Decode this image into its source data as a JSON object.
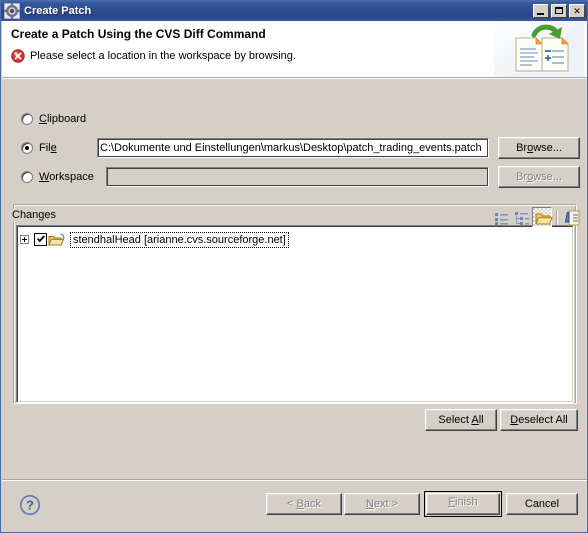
{
  "window": {
    "title": "Create Patch",
    "title_icon": "gear-icon",
    "minimize_label": "Minimize",
    "maximize_label": "Maximize",
    "close_label": "Close",
    "close_glyph": "✕",
    "background_color": "#d4d0c8",
    "titlebar_color": "#2d4b8e"
  },
  "header": {
    "title": "Create a Patch Using the CVS Diff Command",
    "message": "Please select a location in the workspace by browsing.",
    "message_icon": "error-icon",
    "message_icon_color": "#cc2222",
    "banner_icon": "patch-documents-icon"
  },
  "location": {
    "options": [
      {
        "label_before": "",
        "accel": "C",
        "label_after": "lipboard",
        "selected": false,
        "enabled": true,
        "name": "clipboard"
      },
      {
        "label_before": "Fil",
        "accel": "e",
        "label_after": "",
        "selected": true,
        "enabled": true,
        "name": "file"
      },
      {
        "label_before": "",
        "accel": "W",
        "label_after": "orkspace",
        "selected": false,
        "enabled": true,
        "name": "workspace"
      }
    ],
    "file_path": "C:\\Dokumente und Einstellungen\\markus\\Desktop\\patch_trading_events.patch",
    "workspace_path": "",
    "browse_file": {
      "before": "Br",
      "accel": "o",
      "after": "wse...",
      "enabled": true
    },
    "browse_workspace": {
      "before": "Br",
      "accel": "o",
      "after": "wse...",
      "enabled": false
    }
  },
  "changes": {
    "group_title": "Changes",
    "toolbar": [
      {
        "name": "flat-layout-icon",
        "pressed": false,
        "tooltip": "Flat Layout"
      },
      {
        "name": "tree-layout-icon",
        "pressed": false,
        "tooltip": "Tree Layout"
      },
      {
        "name": "compressed-folders-icon",
        "pressed": true,
        "tooltip": "Compressed Folders"
      },
      {
        "name": "change-sets-icon",
        "pressed": false,
        "tooltip": "Change Sets"
      }
    ],
    "tree": [
      {
        "icon": "cvs-repository-icon",
        "checked": true,
        "expanded": false,
        "label": "stendhalHead   [arianne.cvs.sourceforge.net]"
      }
    ],
    "select_all": {
      "before": "Select ",
      "accel": "A",
      "after": "ll",
      "enabled": true
    },
    "deselect_all": {
      "before": "",
      "accel": "D",
      "after": "eselect All",
      "enabled": true
    }
  },
  "footer": {
    "help_icon": "help-question-icon",
    "back": {
      "before": "< ",
      "accel": "B",
      "after": "ack",
      "enabled": false
    },
    "next": {
      "before": "",
      "accel": "N",
      "after": "ext >",
      "enabled": false
    },
    "finish": {
      "before": "",
      "accel": "F",
      "after": "inish",
      "enabled": false,
      "is_default": true
    },
    "cancel": {
      "before": "Cancel",
      "accel": "",
      "after": "",
      "enabled": true
    }
  }
}
